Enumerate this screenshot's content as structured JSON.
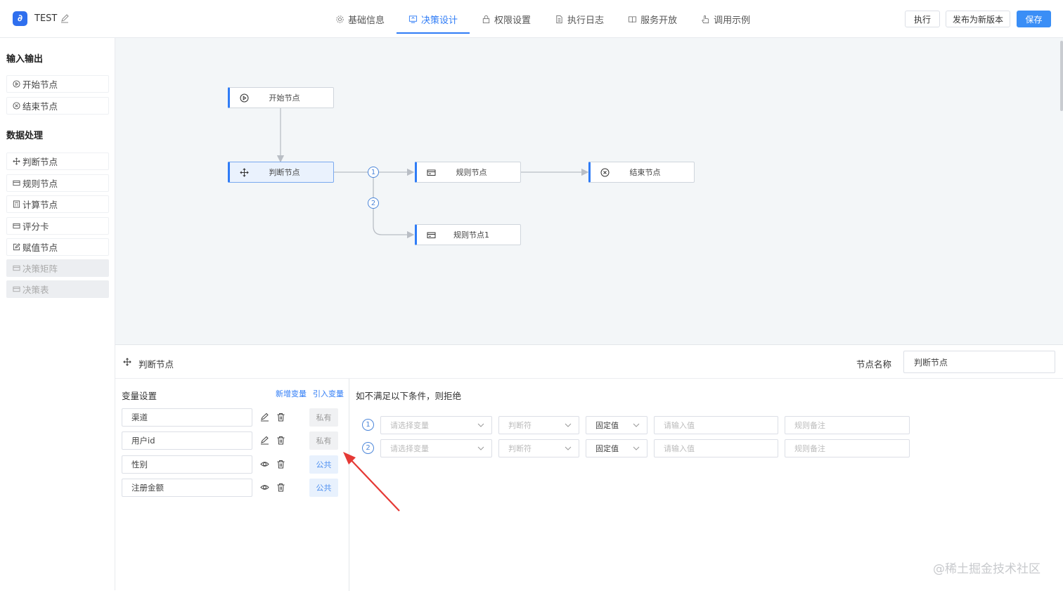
{
  "header": {
    "app_title": "TEST",
    "tabs": [
      {
        "label": "基础信息",
        "icon": "gear-icon"
      },
      {
        "label": "决策设计",
        "icon": "design-icon",
        "active": true
      },
      {
        "label": "权限设置",
        "icon": "lock-icon"
      },
      {
        "label": "执行日志",
        "icon": "document-icon"
      },
      {
        "label": "服务开放",
        "icon": "book-icon"
      },
      {
        "label": "调用示例",
        "icon": "hand-pointer-icon"
      }
    ],
    "run_label": "执行",
    "publish_label": "发布为新版本",
    "save_label": "保存"
  },
  "sidebar": {
    "section_io": "输入输出",
    "io_items": [
      {
        "label": "开始节点",
        "icon": "play-circle-icon"
      },
      {
        "label": "结束节点",
        "icon": "close-circle-icon"
      }
    ],
    "section_data": "数据处理",
    "data_items": [
      {
        "label": "判断节点",
        "icon": "move-icon"
      },
      {
        "label": "规则节点",
        "icon": "card-icon"
      },
      {
        "label": "计算节点",
        "icon": "calculator-icon"
      },
      {
        "label": "评分卡",
        "icon": "card-icon"
      },
      {
        "label": "赋值节点",
        "icon": "edit-icon"
      },
      {
        "label": "决策矩阵",
        "icon": "card-icon",
        "disabled": true
      },
      {
        "label": "决策表",
        "icon": "card-icon",
        "disabled": true
      }
    ]
  },
  "flow": {
    "nodes": {
      "start": "开始节点",
      "judge": "判断节点",
      "rule": "规则节点",
      "end": "结束节点",
      "rule1": "规则节点1"
    },
    "branch_labels": [
      "1",
      "2"
    ]
  },
  "panel": {
    "title": "判断节点",
    "node_name_label": "节点名称",
    "node_name_value": "判断节点",
    "var_title": "变量设置",
    "add_var": "新增变量",
    "import_var": "引入变量",
    "variables": [
      {
        "name": "渠道",
        "action_icon": "edit-icon",
        "scope": "私有"
      },
      {
        "name": "用户id",
        "action_icon": "edit-icon",
        "scope": "私有"
      },
      {
        "name": "性别",
        "action_icon": "eye-icon",
        "scope": "公共"
      },
      {
        "name": "注册金额",
        "action_icon": "eye-icon",
        "scope": "公共"
      }
    ],
    "cond_title": "如不满足以下条件，则拒绝",
    "conditions": [
      {
        "num": "1",
        "var_placeholder": "请选择变量",
        "op_placeholder": "判断符",
        "type": "固定值",
        "value_placeholder": "请输入值",
        "note_placeholder": "规则备注"
      },
      {
        "num": "2",
        "var_placeholder": "请选择变量",
        "op_placeholder": "判断符",
        "type": "固定值",
        "value_placeholder": "请输入值",
        "note_placeholder": "规则备注"
      }
    ]
  },
  "watermark": "@稀土掘金技术社区",
  "colors": {
    "accent": "#2f7cf6",
    "canvas_bg": "#f3f6f8",
    "annotation_arrow": "#e53935"
  }
}
